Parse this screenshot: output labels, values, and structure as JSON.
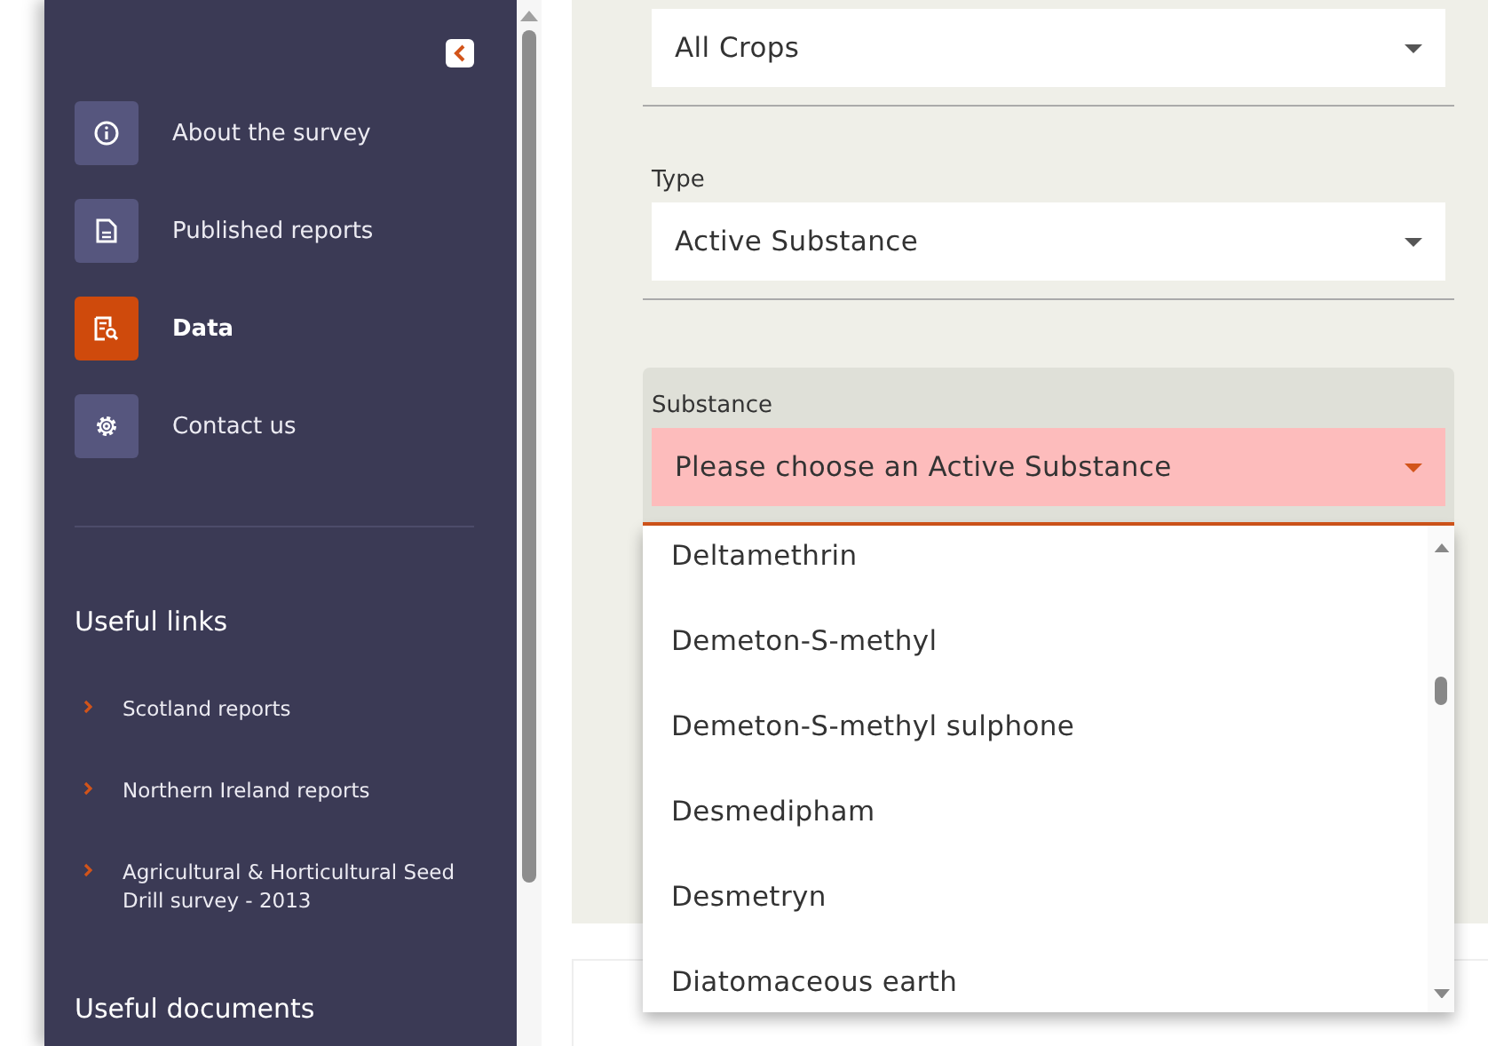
{
  "sidebar": {
    "nav": [
      {
        "label": "About the survey",
        "selected": false
      },
      {
        "label": "Published reports",
        "selected": false
      },
      {
        "label": "Data",
        "selected": true
      },
      {
        "label": "Contact us",
        "selected": false
      }
    ],
    "useful_links": {
      "title": "Useful links",
      "links": [
        "Scotland reports",
        "Northern Ireland reports",
        "Agricultural & Horticultural Seed Drill survey - 2013"
      ]
    },
    "useful_documents": {
      "title": "Useful documents"
    }
  },
  "form": {
    "fields": [
      {
        "value": "All Crops",
        "invalid": false
      },
      {
        "label": "Type",
        "value": "Active Substance",
        "invalid": false
      },
      {
        "label": "Substance",
        "value": "Please choose an Active Substance",
        "invalid": true
      }
    ],
    "dropdown": {
      "options": [
        "Deltamethrin",
        "Demeton-S-methyl",
        "Demeton-S-methyl sulphone",
        "Desmedipham",
        "Desmetryn",
        "Diatomaceous earth"
      ]
    }
  }
}
